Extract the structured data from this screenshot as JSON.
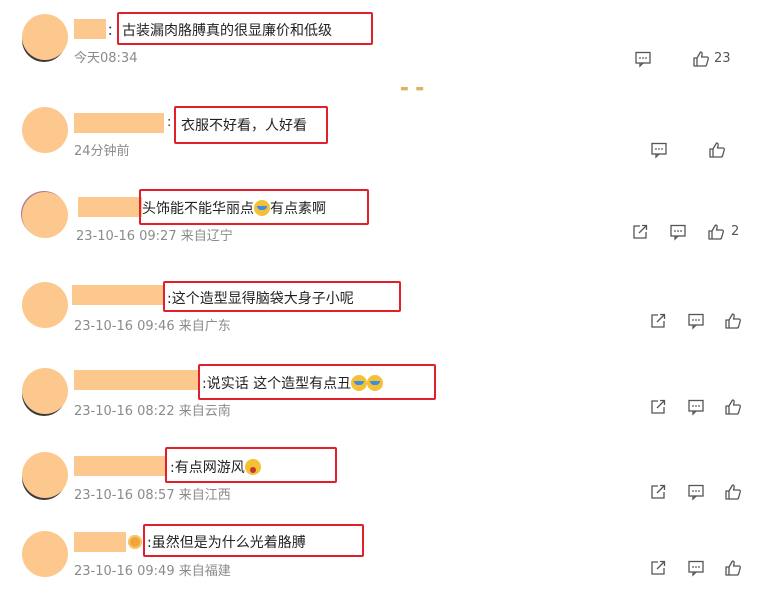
{
  "comments": [
    {
      "text": "古装漏肉胳膊真的很显廉价和低级",
      "meta": "今天08:34",
      "likes": "23"
    },
    {
      "text": "衣服不好看，人好看",
      "meta": "24分钟前",
      "likes": ""
    },
    {
      "text": "头饰能不能华丽点",
      "text_after": "有点素啊",
      "meta": "23-10-16 09:27 来自辽宁",
      "likes": "2"
    },
    {
      "text": ":这个造型显得脑袋大身子小呢",
      "meta": "23-10-16 09:46 来自广东",
      "likes": ""
    },
    {
      "text": ":说实话 这个造型有点丑",
      "meta": "23-10-16 08:22 来自云南",
      "likes": ""
    },
    {
      "text": ":有点网游风",
      "meta": "23-10-16 08:57 来自江西",
      "likes": ""
    },
    {
      "text": ":虽然但是为什么光着胳膊",
      "meta": "23-10-16 09:49 来自福建",
      "likes": ""
    }
  ],
  "colon": "：",
  "colon_plain": ":",
  "icons": {
    "reply": "comment-icon",
    "like": "thumbs-up-icon",
    "share": "share-icon"
  },
  "colors": {
    "highlight": "#e0202a",
    "placeholder": "#fdc88d",
    "meta": "#8b8b8b"
  }
}
